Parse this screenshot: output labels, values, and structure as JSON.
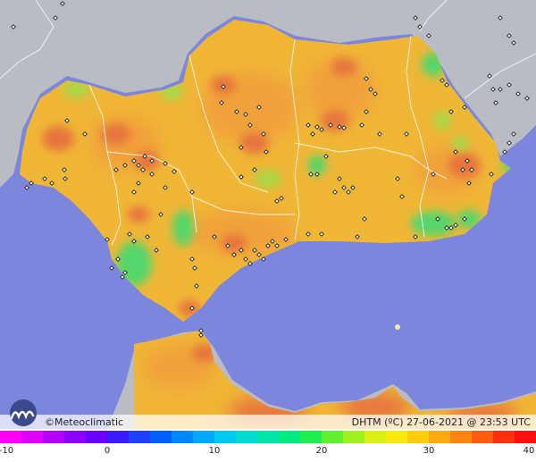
{
  "map": {
    "colors": {
      "sea": "#7b86dc",
      "neighbor_land": "#b9bcc2",
      "heat_base": "#f0b636",
      "heat_mid": "#f1a13a",
      "heat_hot": "#e6743c",
      "heat_cool": "#a9d84a",
      "heat_cold": "#55d66a",
      "border": "#ffffff",
      "station": "#222222"
    }
  },
  "footer": {
    "credit": "©Meteoclimatic",
    "caption": "DHTM (ºC)  27-06-2021 @ 23:53 UTC"
  },
  "legend": {
    "ticks": [
      "-10",
      "0",
      "10",
      "20",
      "30",
      "40"
    ],
    "min": -10,
    "max": 40,
    "gradient": [
      "#ff00ff",
      "#e000ff",
      "#b400ff",
      "#8c00ff",
      "#6a00ff",
      "#3c1cff",
      "#2040ff",
      "#0060ff",
      "#0086ff",
      "#00a8ff",
      "#00c8f0",
      "#00dcd0",
      "#00e6a8",
      "#00ec80",
      "#20ee50",
      "#60f030",
      "#a0f020",
      "#d8f018",
      "#f8ea10",
      "#ffcc10",
      "#ffaa10",
      "#ff8410",
      "#ff5c10",
      "#ff3010",
      "#ff1010"
    ]
  }
}
